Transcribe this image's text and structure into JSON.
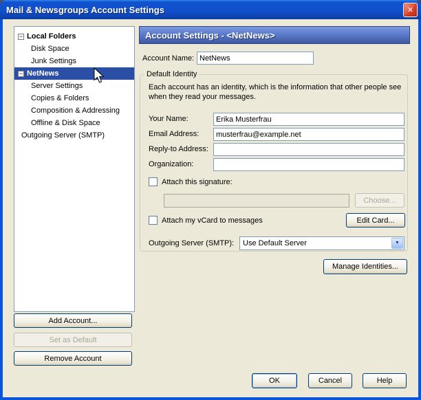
{
  "window": {
    "title": "Mail & Newsgroups Account Settings"
  },
  "icons": {
    "close": "✕",
    "collapse": "−",
    "dropdown_arrow": "▼"
  },
  "colors": {
    "titlebar_blue": "#1152CE",
    "selection_blue": "#2A4FA5",
    "dialog_face": "#ECE9D8",
    "header_blue": "#5B7BCB",
    "disabled_text": "#A9A598"
  },
  "tree": {
    "items": [
      {
        "label": "Local Folders"
      },
      {
        "label": "Disk Space"
      },
      {
        "label": "Junk Settings"
      },
      {
        "label": "NetNews"
      },
      {
        "label": "Server Settings"
      },
      {
        "label": "Copies & Folders"
      },
      {
        "label": "Composition & Addressing"
      },
      {
        "label": "Offline & Disk Space"
      },
      {
        "label": "Outgoing Server (SMTP)"
      }
    ]
  },
  "left_buttons": {
    "add": "Add Account...",
    "set_default": "Set as Default",
    "remove": "Remove Account"
  },
  "panel": {
    "header": "Account Settings - <NetNews>",
    "account_name_label": "Account Name:",
    "account_name_value": "NetNews",
    "identity": {
      "legend": "Default Identity",
      "description": "Each account has an identity, which is the information that other people see when they read your messages.",
      "fields": [
        {
          "label": "Your Name:",
          "value": "Erika Musterfrau"
        },
        {
          "label": "Email Address:",
          "value": "musterfrau@example.net"
        },
        {
          "label": "Reply-to Address:",
          "value": ""
        },
        {
          "label": "Organization:",
          "value": ""
        }
      ],
      "signature_checkbox": "Attach this signature:",
      "signature_value": "",
      "choose_button": "Choose...",
      "vcard_checkbox": "Attach my vCard to messages",
      "edit_card_button": "Edit Card...",
      "smtp_label": "Outgoing Server (SMTP):",
      "smtp_value": "Use Default Server"
    },
    "manage_identities_button": "Manage Identities..."
  },
  "footer": {
    "ok": "OK",
    "cancel": "Cancel",
    "help": "Help"
  }
}
